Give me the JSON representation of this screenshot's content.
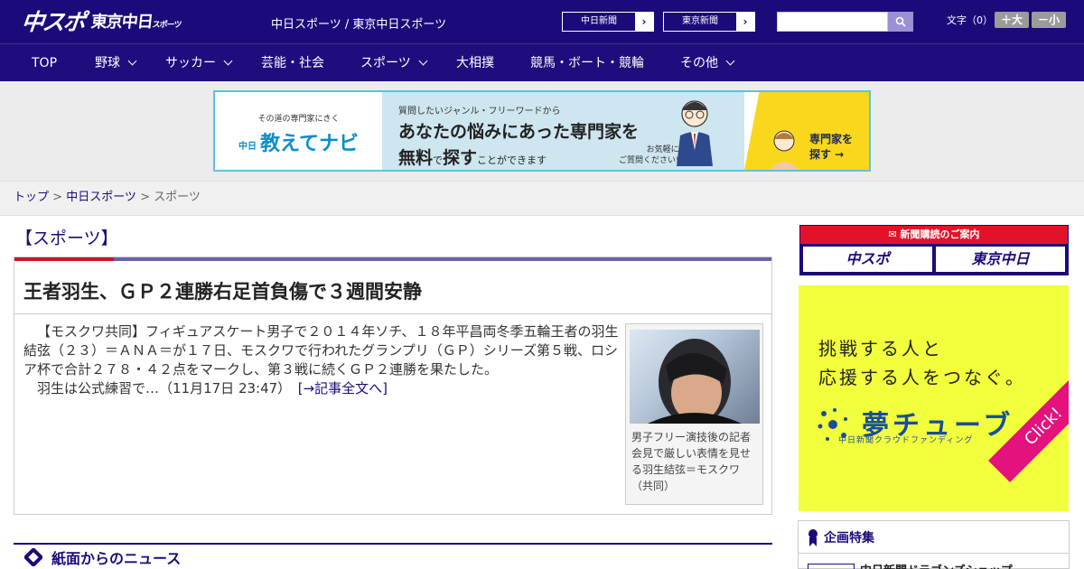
{
  "header": {
    "logo_main": "中スポ",
    "logo_sub": "東京中日",
    "logo_sub_small": "スポーツ",
    "tagline": "中日スポーツ / 東京中日スポーツ",
    "btn_chunichi": "中日新聞",
    "btn_tokyo": "東京新聞",
    "btn_arrow": "›",
    "search_placeholder": "",
    "font_label": "文字（0）",
    "font_big": "＋大",
    "font_small": "－小"
  },
  "nav": {
    "items": [
      "TOP",
      "野球",
      "サッカー",
      "芸能・社会",
      "スポーツ",
      "大相撲",
      "競馬・ボート・競輪",
      "その他"
    ]
  },
  "banner": {
    "small": "その道の専門家にきく",
    "brand_prefix": "中日",
    "brand": "教えてナビ",
    "question": "質問したいジャンル・フリーワードから",
    "headline": "あなたの悩みにあった専門家を",
    "free": "無料",
    "de": "で",
    "search": "探す",
    "can": "ことができます",
    "note1": "お気軽に",
    "note2": "ご質問ください!",
    "cta1": "専門家を",
    "cta2": "探す →"
  },
  "breadcrumb": {
    "top": "トップ",
    "sep": " > ",
    "chunichi": "中日スポーツ",
    "current": "スポーツ"
  },
  "section_title": "【スポーツ】",
  "article": {
    "headline": "王者羽生、ＧＰ２連勝右足首負傷で３週間安静",
    "body": "【モスクワ共同】フィギュアスケート男子で２０１４年ソチ、１８年平昌両冬季五輪王者の羽生結弦（２３）＝ＡＮＡ＝が１７日、モスクワで行われたグランプリ（ＧＰ）シリーズ第５戦、ロシア杯で合計２７８・４２点をマークし、第３戦に続くＧＰ２連勝を果たした。",
    "body2": "羽生は公式練習で…（11月17日 23:47）",
    "more": "[→記事全文へ]",
    "caption": "男子フリー演技後の記者会見で厳しい表情を見せる羽生結弦＝モスクワ（共同）"
  },
  "news_section": "紙面からのニュース",
  "sidebar": {
    "subscribe_header": "新聞購読のご案内",
    "sub_chuspo": "中スポ",
    "sub_tokyo": "東京中日",
    "yume_copy1": "挑戦する人と",
    "yume_copy2": "応援する人をつなぐ。",
    "yume_logo": "夢チューブ",
    "yume_sub": "中日新聞クラウドファンディング",
    "yume_click": "Click!",
    "kikaku_title": "企画特集",
    "kikaku_item": "中日新聞ドラゴンズショップ"
  },
  "colors": {
    "header_bg": "#1b0b7a",
    "accent_red": "#d0122b",
    "yume_bg": "#f2ff3c"
  }
}
